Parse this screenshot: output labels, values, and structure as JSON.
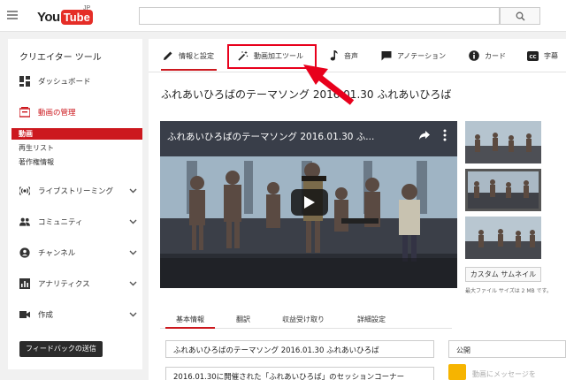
{
  "header": {
    "logo_you": "You",
    "logo_tube": "Tube",
    "logo_region": "JP",
    "search_placeholder": ""
  },
  "sidebar": {
    "title": "クリエイター ツール",
    "items": [
      {
        "label": "ダッシュボード",
        "icon": "dashboard-icon"
      },
      {
        "label": "動画の管理",
        "icon": "video-manager-icon"
      },
      {
        "label": "ライブストリーミング",
        "icon": "live-icon"
      },
      {
        "label": "コミュニティ",
        "icon": "community-icon"
      },
      {
        "label": "チャンネル",
        "icon": "channel-icon"
      },
      {
        "label": "アナリティクス",
        "icon": "analytics-icon"
      },
      {
        "label": "作成",
        "icon": "create-icon"
      }
    ],
    "subitems": [
      {
        "label": "動画"
      },
      {
        "label": "再生リスト"
      },
      {
        "label": "著作権情報"
      }
    ],
    "feedback_label": "フィードバックの送信"
  },
  "tabs": [
    {
      "label": "情報と設定",
      "icon": "pencil-icon"
    },
    {
      "label": "動画加工ツール",
      "icon": "magic-wand-icon"
    },
    {
      "label": "音声",
      "icon": "music-note-icon"
    },
    {
      "label": "アノテーション",
      "icon": "annotation-icon"
    },
    {
      "label": "カード",
      "icon": "info-card-icon"
    },
    {
      "label": "字幕",
      "icon": "cc-icon"
    }
  ],
  "video": {
    "page_title": "ふれあいひろばのテーマソング 2016.01.30 ふれあいひろば",
    "player_title": "ふれあいひろばのテーマソング 2016.01.30 ふ..."
  },
  "thumbnails": {
    "custom_button": "カスタム サムネイル",
    "note": "最大ファイル サイズは 2 MB です。"
  },
  "subtabs": [
    {
      "label": "基本情報"
    },
    {
      "label": "翻訳"
    },
    {
      "label": "収益受け取り"
    },
    {
      "label": "詳細設定"
    }
  ],
  "form": {
    "title_value": "ふれあいひろばのテーマソング 2016.01.30 ふれあいひろば",
    "description_value": "2016.01.30に開催された「ふれあいひろば」のセッションコーナー",
    "privacy_label": "公開",
    "message_placeholder": "動画にメッセージを"
  },
  "colors": {
    "accent": "#cc181e",
    "highlight_box": "#e8001c"
  }
}
